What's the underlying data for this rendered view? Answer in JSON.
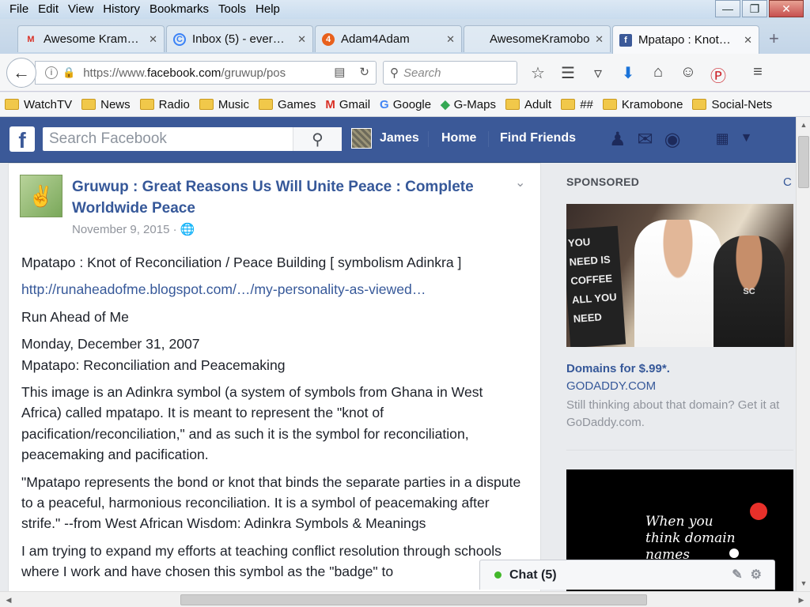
{
  "menu": [
    "File",
    "Edit",
    "View",
    "History",
    "Bookmarks",
    "Tools",
    "Help"
  ],
  "tabs": [
    {
      "label": "Awesome Kram…",
      "icon": "M",
      "iconColor": "#d93025",
      "active": false
    },
    {
      "label": "Inbox (5) - ever…",
      "icon": "C",
      "iconColor": "#3b82f6",
      "active": false
    },
    {
      "label": "Adam4Adam",
      "icon": "4",
      "iconColor": "#e8601c",
      "active": false
    },
    {
      "label": "AwesomeKramobo…",
      "icon": "",
      "iconColor": "",
      "active": false
    },
    {
      "label": "Mpatapo : Knot…",
      "icon": "f",
      "iconColor": "#3b5998",
      "active": true
    }
  ],
  "newtab": "+",
  "nav": {
    "url_prefix": "https://www.",
    "url_host": "facebook.com",
    "url_path": "/gruwup/pos",
    "search_placeholder": "Search"
  },
  "bookmarks": [
    {
      "label": "WatchTV",
      "type": "folder"
    },
    {
      "label": "News",
      "type": "folder"
    },
    {
      "label": "Radio",
      "type": "folder"
    },
    {
      "label": "Music",
      "type": "folder"
    },
    {
      "label": "Games",
      "type": "folder"
    },
    {
      "label": "Gmail",
      "type": "gmail"
    },
    {
      "label": "Google",
      "type": "google"
    },
    {
      "label": "G-Maps",
      "type": "gmaps"
    },
    {
      "label": "Adult",
      "type": "folder"
    },
    {
      "label": "##",
      "type": "folder"
    },
    {
      "label": "Kramobone",
      "type": "folder"
    },
    {
      "label": "Social-Nets",
      "type": "folder"
    }
  ],
  "fb": {
    "logo": "f",
    "search_placeholder": "Search Facebook",
    "user": "James",
    "home": "Home",
    "find_friends": "Find Friends"
  },
  "post": {
    "title": "Gruwup : Great Reasons Us Will Unite Peace : Complete Worldwide Peace",
    "date": "November 9, 2015 · ",
    "paragraphs": [
      "Mpatapo : Knot of Reconciliation / Peace Building [ symbolism Adinkra ]",
      "http://runaheadofme.blogspot.com/…/my-personality-as-viewed…",
      "Run Ahead of Me",
      "Monday, December 31, 2007",
      "Mpatapo: Reconciliation and Peacemaking",
      "This image is an Adinkra symbol (a system of symbols from Ghana in West Africa) called mpatapo. It is meant to represent the \"knot of pacification/reconciliation,\" and as such it is the symbol for reconciliation, peacemaking and pacification.",
      "\"Mpatapo represents the bond or knot that binds the separate parties in a dispute to a peaceful, harmonious reconciliation. It is a symbol of peacemaking after strife.\" --from West African Wisdom: Adinkra Symbols & Meanings",
      "I am trying to expand my efforts at teaching conflict resolution through schools where I work and have chosen this symbol as the \"badge\" to"
    ]
  },
  "sidebar": {
    "sponsored": "SPONSORED",
    "create_ad": "C",
    "ad1": {
      "board_text": "YOU NEED IS COFFEE ALL YOU NEED",
      "shirt_text": "SC",
      "title": "Domains for $.99*.",
      "domain": "GODADDY.COM",
      "desc": "Still thinking about that domain? Get it at GoDaddy.com."
    },
    "ad2": {
      "text": "When you think domain names"
    }
  },
  "chat": {
    "label": "Chat (5)"
  }
}
